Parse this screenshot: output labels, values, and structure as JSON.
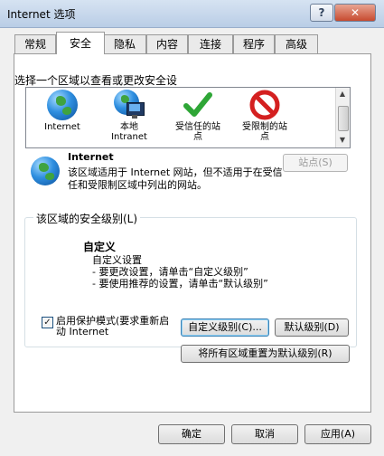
{
  "window": {
    "title": "Internet 选项",
    "help_label": "?",
    "close_label": "✕"
  },
  "tabs": [
    {
      "label": "常规",
      "active": false
    },
    {
      "label": "安全",
      "active": true
    },
    {
      "label": "隐私",
      "active": false
    },
    {
      "label": "内容",
      "active": false
    },
    {
      "label": "连接",
      "active": false
    },
    {
      "label": "程序",
      "active": false
    },
    {
      "label": "高级",
      "active": false
    }
  ],
  "zones": {
    "heading": "选择一个区域以查看或更改安全设",
    "items": [
      {
        "label": "Internet",
        "icon": "globe-icon"
      },
      {
        "label": "本地\nIntranet",
        "icon": "intranet-icon"
      },
      {
        "label": "受信任的站\n点",
        "icon": "checkmark-icon"
      },
      {
        "label": "受限制的站\n点",
        "icon": "prohibited-icon"
      }
    ]
  },
  "selected_zone": {
    "name": "Internet",
    "description": "该区域适用于 Internet 网站，但不适用于在受信任和受限制区域中列出的网站。",
    "sites_button": "站点(S)"
  },
  "security_level": {
    "group_title": "该区域的安全级别(L)",
    "level_name": "自定义",
    "description_lines": "自定义设置\n- 要更改设置，请单击“自定义级别”\n- 要使用推荐的设置，请单击“默认级别”",
    "protected_mode_label": "启用保护模式(要求重新启动 Internet",
    "protected_mode_checked": true,
    "custom_level_button": "自定义级别(C)...",
    "default_level_button": "默认级别(D)",
    "reset_all_button": "将所有区域重置为默认级别(R)"
  },
  "footer": {
    "ok_button": "确定",
    "cancel_button": "取消",
    "apply_button": "应用(A)"
  }
}
